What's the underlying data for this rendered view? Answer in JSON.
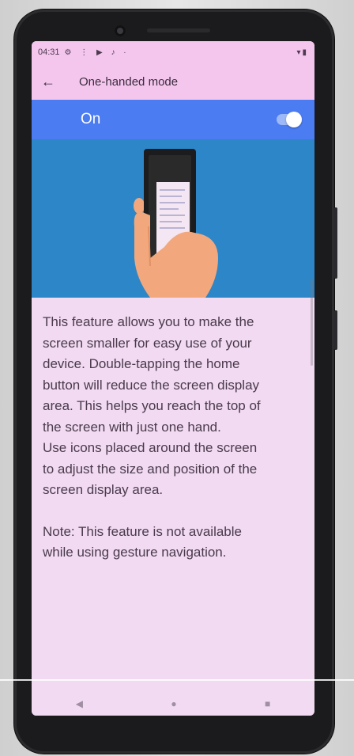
{
  "status_bar": {
    "time": "04:31",
    "left_icons": [
      "settings-icon",
      "notification-icon",
      "play-icon",
      "notification-icon",
      "dot-icon"
    ],
    "right_icons": [
      "signal-icon",
      "battery-icon"
    ]
  },
  "app_bar": {
    "back_icon": "arrow-back-icon",
    "title": "One-handed mode"
  },
  "master_switch": {
    "label": "On",
    "checked": true,
    "accent": "#4b7cf2"
  },
  "illustration": {
    "background": "#2d86c8",
    "icon": "phone-in-hand-illustration"
  },
  "description": "This feature allows you to make the\nscreen smaller for easy use of your\ndevice. Double-tapping the home\nbutton will reduce the screen display\narea. This helps you reach the top of\nthe screen with just one hand.\nUse icons placed around the screen\nto adjust the size and position of the\nscreen display area.",
  "note": "Note: This feature is not available\nwhile using gesture navigation.",
  "nav_bar": {
    "back": "◀",
    "home": "●",
    "recents": "■"
  }
}
